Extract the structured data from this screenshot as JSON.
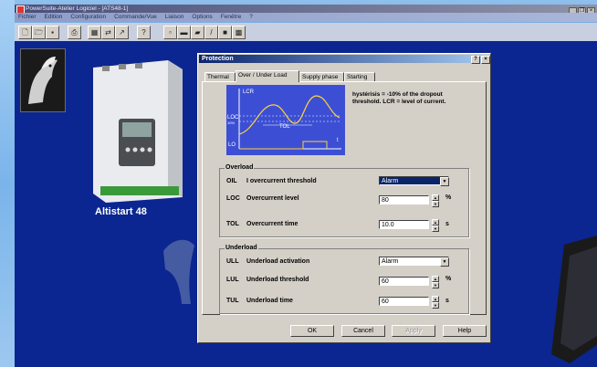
{
  "app": {
    "title": "PowerSuite-Atelier Logiciel - [ATS48-1]",
    "menu": [
      "Fichier",
      "Edition",
      "Configuration",
      "Commande/Vue",
      "Liaison",
      "Options",
      "Fenêtre",
      "?"
    ],
    "window_controls": [
      "_",
      "❐",
      "×"
    ]
  },
  "toolbar": {
    "buttons": [
      {
        "name": "new-file-icon",
        "glyph": "🗋"
      },
      {
        "name": "open-folder-icon",
        "glyph": "🗁"
      },
      {
        "name": "save-icon",
        "glyph": "▪"
      },
      {
        "name": "print-icon",
        "glyph": "⎙"
      },
      {
        "name": "grid-icon",
        "glyph": "▦"
      },
      {
        "name": "compare-icon",
        "glyph": "⇄"
      },
      {
        "name": "transfer-icon",
        "glyph": "↗"
      },
      {
        "name": "help-pointer-icon",
        "glyph": "?"
      },
      {
        "name": "connect-icon",
        "glyph": "▫"
      },
      {
        "name": "monitor-icon",
        "glyph": "▬"
      },
      {
        "name": "drive-icon",
        "glyph": "▰"
      },
      {
        "name": "edit-icon",
        "glyph": "/"
      },
      {
        "name": "stop-icon",
        "glyph": "■"
      },
      {
        "name": "keypad-icon",
        "glyph": "▩"
      }
    ]
  },
  "device": {
    "label": "Altistart 48"
  },
  "dialog": {
    "title": "Protection",
    "help_glyph": "?",
    "close_glyph": "×",
    "tabs": [
      "Thermal",
      "Over / Under Load",
      "Supply phase",
      "Starting"
    ],
    "active_tab": 1,
    "graph": {
      "lcr": "LCR",
      "loc": "LOC",
      "hyst": "10%",
      "tol": "TOL",
      "lo": "LO",
      "t": "t"
    },
    "note": "hystérisis = -10% of the dropout threshold. LCR = level of current.",
    "overload": {
      "group": "Overload",
      "oil": {
        "code": "OIL",
        "label": "I overcurrent threshold",
        "value": "Alarm"
      },
      "loc": {
        "code": "LOC",
        "label": "Overcurrent level",
        "value": "80",
        "unit": "%"
      },
      "tol": {
        "code": "TOL",
        "label": "Overcurrent time",
        "value": "10.0",
        "unit": "s"
      }
    },
    "underload": {
      "group": "Underload",
      "ull": {
        "code": "ULL",
        "label": "Underload activation",
        "value": "Alarm"
      },
      "lul": {
        "code": "LUL",
        "label": "Underload threshold",
        "value": "60",
        "unit": "%"
      },
      "tul": {
        "code": "TUL",
        "label": "Underload time",
        "value": "60",
        "unit": "s"
      }
    },
    "buttons": {
      "ok": "OK",
      "cancel": "Cancel",
      "apply": "Apply",
      "help": "Help"
    }
  }
}
